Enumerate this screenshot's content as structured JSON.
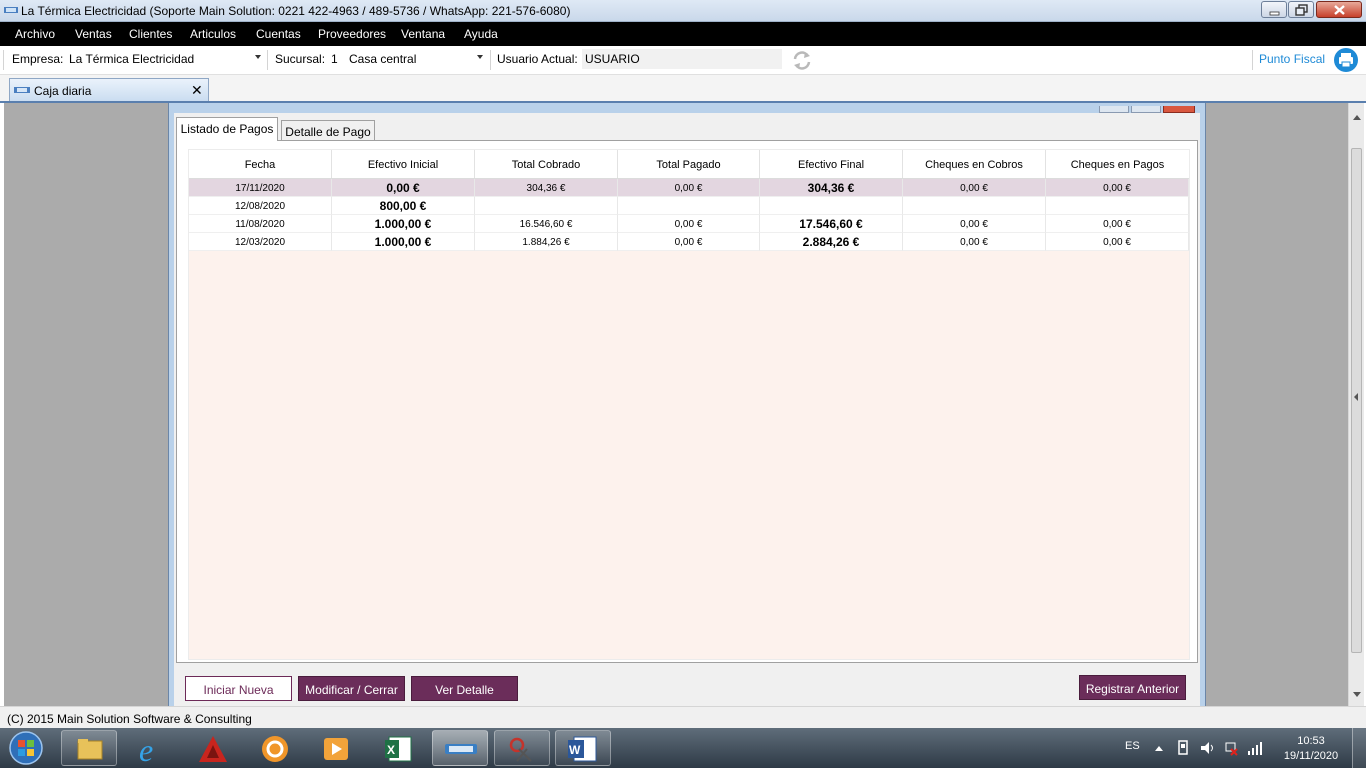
{
  "window": {
    "title": "La Térmica Electricidad (Soporte Main Solution: 0221 422-4963 / 489-5736 / WhatsApp: 221-576-6080)"
  },
  "menu": {
    "items": [
      "Archivo",
      "Ventas",
      "Clientes",
      "Articulos",
      "Cuentas",
      "Proveedores",
      "Ventana",
      "Ayuda"
    ]
  },
  "toolbar": {
    "empresa_label": "Empresa:",
    "empresa_value": "La Térmica Electricidad",
    "sucursal_label": "Sucursal:",
    "sucursal_number": "1",
    "sucursal_name": "Casa central",
    "usuario_label": "Usuario Actual:",
    "usuario_value": "USUARIO",
    "punto_fiscal": "Punto Fiscal"
  },
  "doc_tab": {
    "label": "Caja diaria"
  },
  "child_window": {
    "caption_partial": "Caja diaria"
  },
  "tabs": {
    "active": "Listado de Pagos",
    "inactive": "Detalle de Pago"
  },
  "grid": {
    "columns": [
      "Fecha",
      "Efectivo Inicial",
      "Total Cobrado",
      "Total Pagado",
      "Efectivo Final",
      "Cheques en Cobros",
      "Cheques en Pagos"
    ],
    "rows": [
      [
        "17/11/2020",
        "0,00 €",
        "304,36 €",
        "0,00 €",
        "304,36 €",
        "0,00 €",
        "0,00 €"
      ],
      [
        "12/08/2020",
        "800,00 €",
        "",
        "",
        "",
        "",
        ""
      ],
      [
        "11/08/2020",
        "1.000,00 €",
        "16.546,60 €",
        "0,00 €",
        "17.546,60 €",
        "0,00 €",
        "0,00 €"
      ],
      [
        "12/03/2020",
        "1.000,00 €",
        "1.884,26 €",
        "0,00 €",
        "2.884,26 €",
        "0,00 €",
        "0,00 €"
      ]
    ],
    "selected_row": 0
  },
  "buttons": {
    "iniciar": "Iniciar Nueva",
    "modificar": "Modificar / Cerrar",
    "ver": "Ver Detalle",
    "registrar": "Registrar Anterior"
  },
  "status": {
    "text": "(C) 2015 Main Solution Software & Consulting"
  },
  "taskbar": {
    "items": [
      "start-orb",
      "file-explorer-icon",
      "internet-explorer-icon",
      "autocad-icon",
      "settings-app-icon",
      "media-player-icon",
      "excel-icon",
      "comit-app-icon",
      "snipping-tool-icon",
      "word-icon"
    ],
    "active_item": "comit-app-icon",
    "language": "ES",
    "time": "10:53",
    "date": "19/11/2020"
  },
  "colors": {
    "accent": "#6b2d5a",
    "grid_bg": "#fdf2ed",
    "selected_row": "#e3d6e0",
    "link": "#1e8ad6"
  }
}
